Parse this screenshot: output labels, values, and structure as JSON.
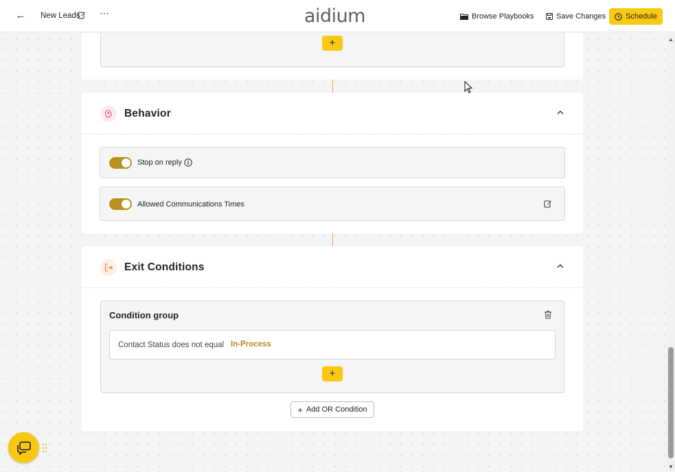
{
  "header": {
    "title": "New Leads",
    "logo": "aidium",
    "browse_label": "Browse Playbooks",
    "save_label": "Save Changes",
    "schedule_label": "Schedule"
  },
  "behavior": {
    "title": "Behavior",
    "stop_on_reply_label": "Stop on reply",
    "stop_on_reply_enabled": true,
    "allowed_times_label": "Allowed Communications Times",
    "allowed_times_enabled": true
  },
  "exit_conditions": {
    "title": "Exit Conditions",
    "group_title": "Condition group",
    "condition_text": "Contact Status does not equal",
    "condition_value": "In-Process",
    "add_or_label": "Add OR Condition"
  },
  "colors": {
    "accent": "#f9c812",
    "toggle": "#b8901c",
    "value_text": "#b38a16"
  }
}
